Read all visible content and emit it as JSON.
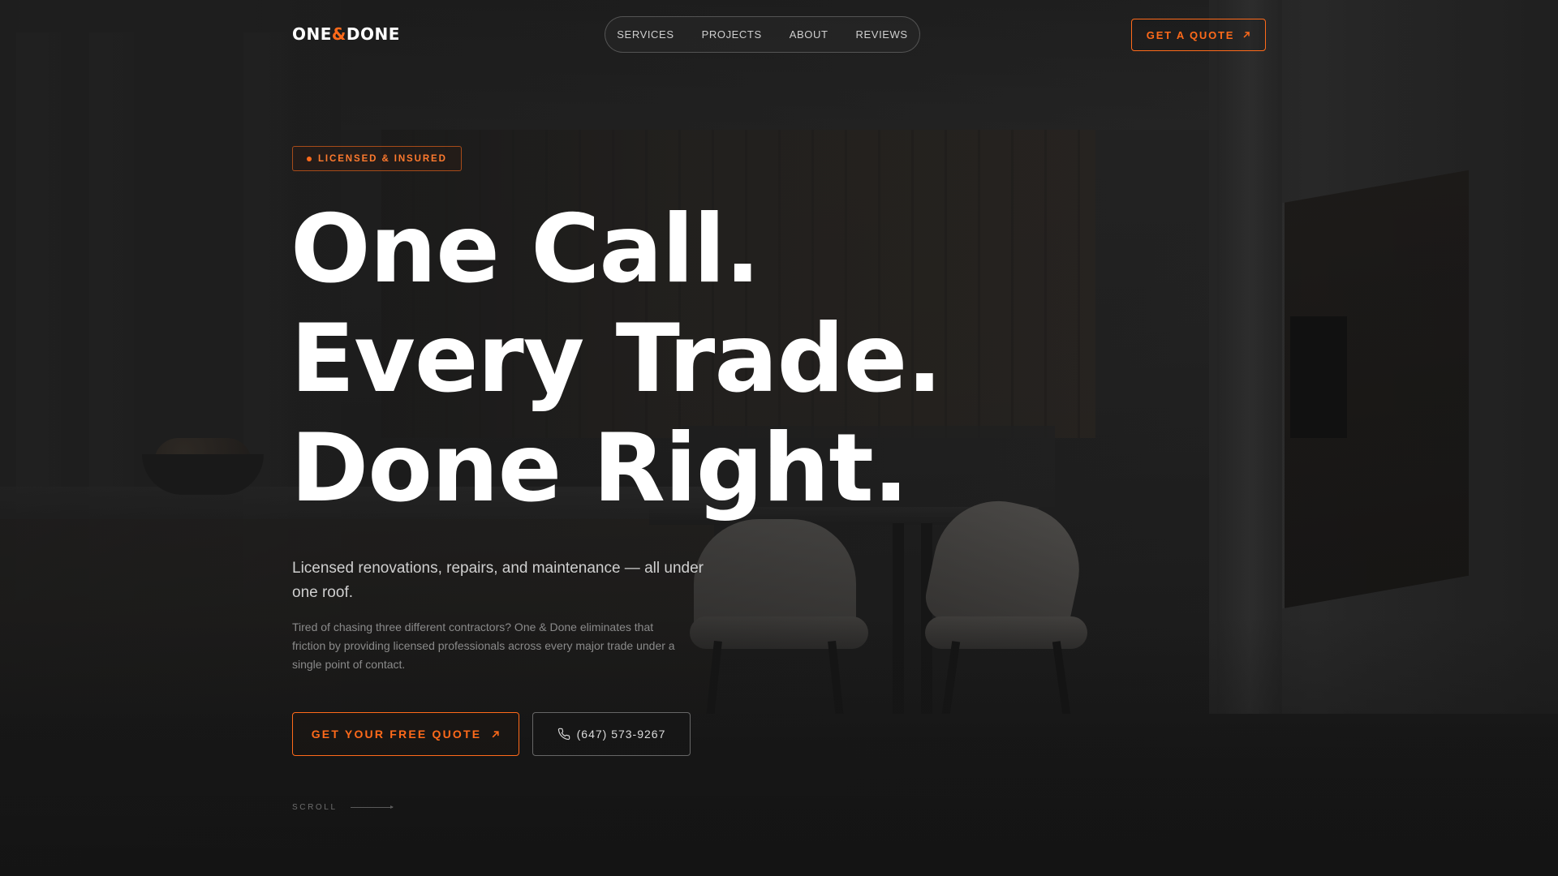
{
  "brand": {
    "logo_part1": "ONE",
    "logo_amp": "&",
    "logo_part2": "DONE",
    "accent_color": "#ff6a1a"
  },
  "nav": {
    "items": [
      {
        "label": "SERVICES"
      },
      {
        "label": "PROJECTS"
      },
      {
        "label": "ABOUT"
      },
      {
        "label": "REVIEWS"
      }
    ],
    "quote_button": {
      "label": "GET A QUOTE",
      "icon": "arrow-up-right-icon"
    }
  },
  "hero": {
    "badge": "LICENSED & INSURED",
    "headline": [
      "One Call.",
      "Every Trade.",
      "Done Right."
    ],
    "subheading": "Licensed renovations, repairs, and maintenance — all under one roof.",
    "description": "Tired of chasing three different contractors? One & Done eliminates that friction by providing licensed professionals across every major trade under a single point of contact.",
    "primary_cta": {
      "label": "GET YOUR FREE QUOTE",
      "icon": "arrow-up-right-icon"
    },
    "phone_cta": {
      "label": "(647) 573-9267",
      "icon": "phone-icon"
    },
    "scroll_label": "SCROLL"
  }
}
